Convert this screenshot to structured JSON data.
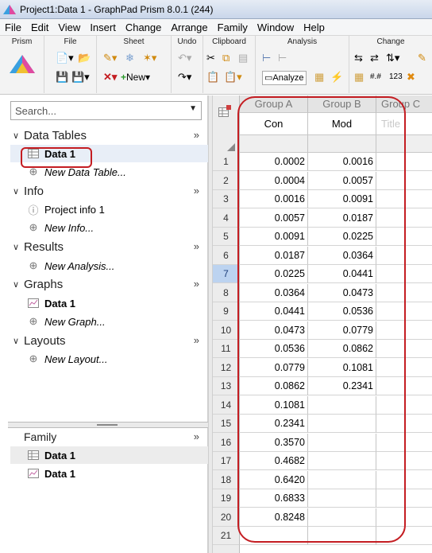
{
  "window": {
    "title": "Project1:Data 1 - GraphPad Prism 8.0.1 (244)"
  },
  "menu": [
    "File",
    "Edit",
    "View",
    "Insert",
    "Change",
    "Arrange",
    "Family",
    "Window",
    "Help"
  ],
  "ribbon": {
    "groups": [
      "Prism",
      "File",
      "Sheet",
      "Undo",
      "Clipboard",
      "Analysis",
      "Change"
    ],
    "new_label": "New",
    "analyze_label": "Analyze"
  },
  "navigator": {
    "search_placeholder": "Search...",
    "sections": [
      {
        "title": "Data Tables",
        "items": [
          {
            "label": "Data 1",
            "icon": "table-icon",
            "bold": true
          },
          {
            "label": "New Data Table...",
            "icon": "plus-circle-icon",
            "italic": true
          }
        ]
      },
      {
        "title": "Info",
        "items": [
          {
            "label": "Project info 1",
            "icon": "info-icon"
          },
          {
            "label": "New Info...",
            "icon": "plus-circle-icon",
            "italic": true
          }
        ]
      },
      {
        "title": "Results",
        "items": [
          {
            "label": "New Analysis...",
            "icon": "plus-circle-icon",
            "italic": true
          }
        ]
      },
      {
        "title": "Graphs",
        "items": [
          {
            "label": "Data 1",
            "icon": "graph-icon",
            "bold": true
          },
          {
            "label": "New Graph...",
            "icon": "plus-circle-icon",
            "italic": true
          }
        ]
      },
      {
        "title": "Layouts",
        "items": [
          {
            "label": "New Layout...",
            "icon": "plus-circle-icon",
            "italic": true
          }
        ]
      }
    ],
    "expand_glyph": "»",
    "family": {
      "title": "Family",
      "items": [
        {
          "label": "Data 1",
          "icon": "table-icon"
        },
        {
          "label": "Data 1",
          "icon": "graph-icon"
        }
      ]
    }
  },
  "sheet": {
    "columns": [
      {
        "group": "Group A",
        "title": "Con"
      },
      {
        "group": "Group B",
        "title": "Mod"
      },
      {
        "group": "Group C",
        "title": "Title"
      }
    ],
    "row_numbers": [
      "1",
      "2",
      "3",
      "4",
      "5",
      "6",
      "7",
      "8",
      "9",
      "10",
      "11",
      "12",
      "13",
      "14",
      "15",
      "16",
      "17",
      "18",
      "19",
      "20",
      "21"
    ],
    "active_row": "7",
    "group_a": [
      "0.0002",
      "0.0004",
      "0.0016",
      "0.0057",
      "0.0091",
      "0.0187",
      "0.0225",
      "0.0364",
      "0.0441",
      "0.0473",
      "0.0536",
      "0.0779",
      "0.0862",
      "0.1081",
      "0.2341",
      "0.3570",
      "0.4682",
      "0.6420",
      "0.6833",
      "0.8248"
    ],
    "group_b": [
      "0.0016",
      "0.0057",
      "0.0091",
      "0.0187",
      "0.0225",
      "0.0364",
      "0.0441",
      "0.0473",
      "0.0536",
      "0.0779",
      "0.0862",
      "0.1081",
      "0.2341"
    ]
  },
  "colors": {
    "annotation": "#c41d22",
    "active_row": "#bcd3f0",
    "selection": "#e8eef7"
  }
}
